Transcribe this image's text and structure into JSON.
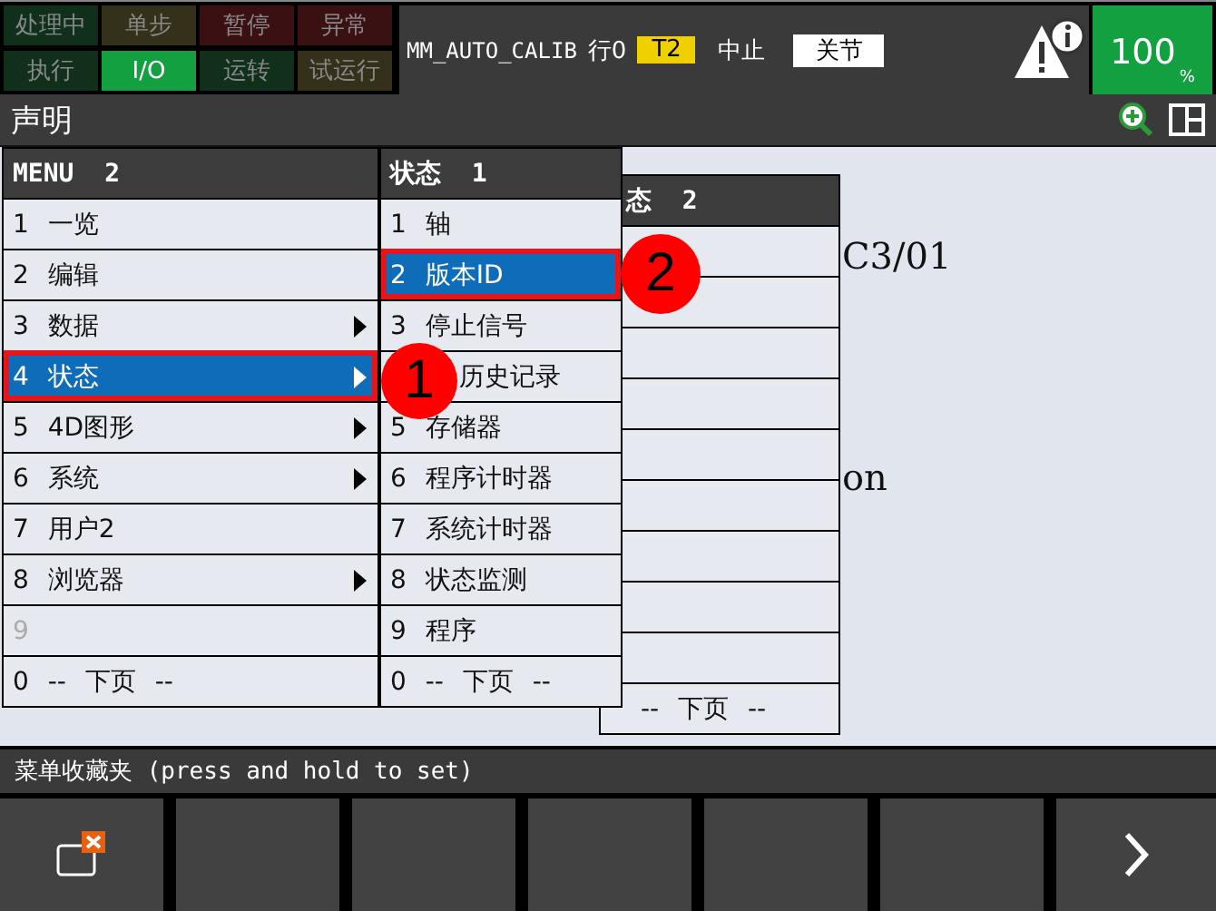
{
  "status_lamps": [
    {
      "label": "处理中",
      "on": false,
      "color": "#10301c"
    },
    {
      "label": "单步",
      "on": false,
      "color": "#35301a"
    },
    {
      "label": "暂停",
      "on": false,
      "color": "#3a1012"
    },
    {
      "label": "异常",
      "on": false,
      "color": "#3a1012"
    },
    {
      "label": "执行",
      "on": false,
      "color": "#10301c"
    },
    {
      "label": "I/O",
      "on": true,
      "color": "#12a040"
    },
    {
      "label": "运转",
      "on": false,
      "color": "#10301c"
    },
    {
      "label": "试运行",
      "on": false,
      "color": "#35301a"
    }
  ],
  "program": "MM_AUTO_CALIB",
  "line": "行0",
  "mode": "T2",
  "state": "中止",
  "coord": "关节",
  "override": "100",
  "override_unit": "%",
  "screen_title": "声明",
  "content_texts": [
    "C3/01",
    "on"
  ],
  "menus": [
    {
      "title": "MENU  2",
      "items": [
        {
          "label": "1 一览",
          "kind": "full",
          "selected": false,
          "disabled": false,
          "submenu": false
        },
        {
          "label": "2 编辑",
          "kind": "full",
          "selected": false,
          "disabled": false,
          "submenu": false
        },
        {
          "label": "3 数据",
          "kind": "full",
          "selected": false,
          "disabled": false,
          "submenu": true
        },
        {
          "label": "4 状态",
          "kind": "full",
          "selected": true,
          "disabled": false,
          "submenu": true
        },
        {
          "label": "5 4D图形",
          "kind": "full",
          "selected": false,
          "disabled": false,
          "submenu": true
        },
        {
          "label": "6 系统",
          "kind": "full",
          "selected": false,
          "disabled": false,
          "submenu": true
        },
        {
          "label": "7 用户2",
          "kind": "full",
          "selected": false,
          "disabled": false,
          "submenu": false
        },
        {
          "label": "8 浏览器",
          "kind": "full",
          "selected": false,
          "disabled": false,
          "submenu": true
        },
        {
          "label": "9",
          "kind": "full",
          "selected": false,
          "disabled": true,
          "submenu": false
        },
        {
          "label": "0 -- 下页 --",
          "kind": "full",
          "selected": false,
          "disabled": false,
          "submenu": false
        }
      ]
    },
    {
      "title": "状态  1",
      "items": [
        {
          "label": "1 轴",
          "kind": "full",
          "selected": false,
          "disabled": false,
          "submenu": false
        },
        {
          "label": "2 版本ID",
          "kind": "full",
          "selected": true,
          "disabled": false,
          "submenu": false
        },
        {
          "label": "3 停止信号",
          "kind": "full",
          "selected": false,
          "disabled": false,
          "submenu": false
        },
        {
          "label": "历史记录",
          "kind": "partial",
          "selected": false,
          "disabled": false,
          "submenu": false
        },
        {
          "label": "5 存储器",
          "kind": "full",
          "selected": false,
          "disabled": false,
          "submenu": false
        },
        {
          "label": "6 程序计时器",
          "kind": "full",
          "selected": false,
          "disabled": false,
          "submenu": false
        },
        {
          "label": "7 系统计时器",
          "kind": "full",
          "selected": false,
          "disabled": false,
          "submenu": false
        },
        {
          "label": "8 状态监测",
          "kind": "full",
          "selected": false,
          "disabled": false,
          "submenu": false
        },
        {
          "label": "9 程序",
          "kind": "full",
          "selected": false,
          "disabled": false,
          "submenu": false
        },
        {
          "label": "0 -- 下页 --",
          "kind": "full",
          "selected": false,
          "disabled": false,
          "submenu": false
        }
      ]
    }
  ],
  "back_menu": {
    "title": "态  2",
    "footer": "-- 下页 --"
  },
  "callouts": [
    "1",
    "2"
  ],
  "favorites_bar": "菜单收藏夹 (press and hold to set)",
  "function_keys": [
    {
      "kind": "close-window"
    },
    {
      "kind": "blank"
    },
    {
      "kind": "blank"
    },
    {
      "kind": "blank"
    },
    {
      "kind": "blank"
    },
    {
      "kind": "blank"
    },
    {
      "kind": "next"
    }
  ]
}
